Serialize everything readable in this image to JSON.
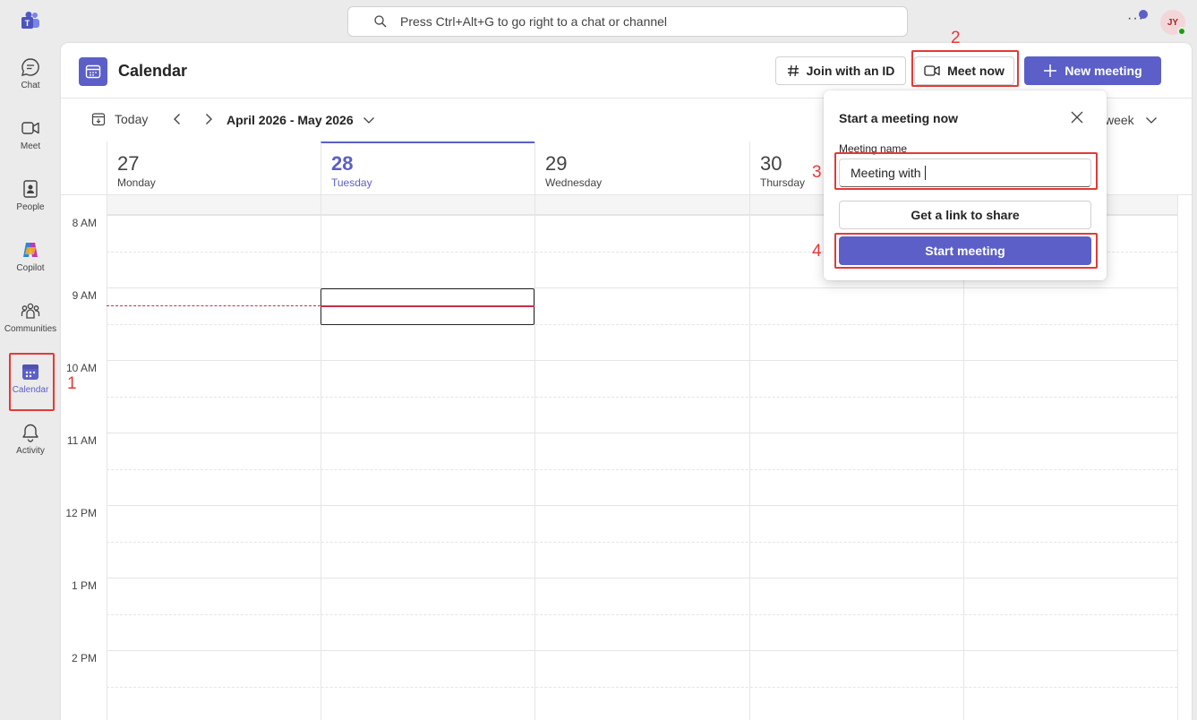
{
  "topbar": {
    "search_placeholder": "Press Ctrl+Alt+G to go right to a chat or channel",
    "more_label": "···",
    "avatar_initials": "JY"
  },
  "rail": {
    "items": [
      {
        "label": "Chat",
        "icon": "chat-icon"
      },
      {
        "label": "Meet",
        "icon": "video-icon"
      },
      {
        "label": "People",
        "icon": "people-icon"
      },
      {
        "label": "Copilot",
        "icon": "copilot-icon"
      },
      {
        "label": "Communities",
        "icon": "communities-icon"
      },
      {
        "label": "Calendar",
        "icon": "calendar-icon",
        "active": true
      },
      {
        "label": "Activity",
        "icon": "bell-icon"
      }
    ]
  },
  "calendar": {
    "title": "Calendar",
    "join_id_label": "Join with an ID",
    "meet_now_label": "Meet now",
    "new_meeting_label": "New meeting",
    "today_label": "Today",
    "date_range": "April 2026 - May 2026",
    "view_label": "week",
    "days": [
      {
        "num": "27",
        "name": "Monday"
      },
      {
        "num": "28",
        "name": "Tuesday",
        "today": true
      },
      {
        "num": "29",
        "name": "Wednesday"
      },
      {
        "num": "30",
        "name": "Thursday"
      },
      {
        "num": "",
        "name": ""
      }
    ],
    "hours": [
      "8 AM",
      "9 AM",
      "10 AM",
      "11 AM",
      "12 PM",
      "1 PM",
      "2 PM"
    ]
  },
  "popup": {
    "title": "Start a meeting now",
    "field_label": "Meeting name",
    "field_value": "Meeting with",
    "link_button": "Get a link to share",
    "start_button": "Start meeting"
  },
  "annotations": {
    "step1": "1",
    "step2": "2",
    "step3": "3",
    "step4": "4"
  },
  "colors": {
    "accent": "#5b5fc7",
    "annotation": "#e53935",
    "now_line": "#c4314b"
  }
}
